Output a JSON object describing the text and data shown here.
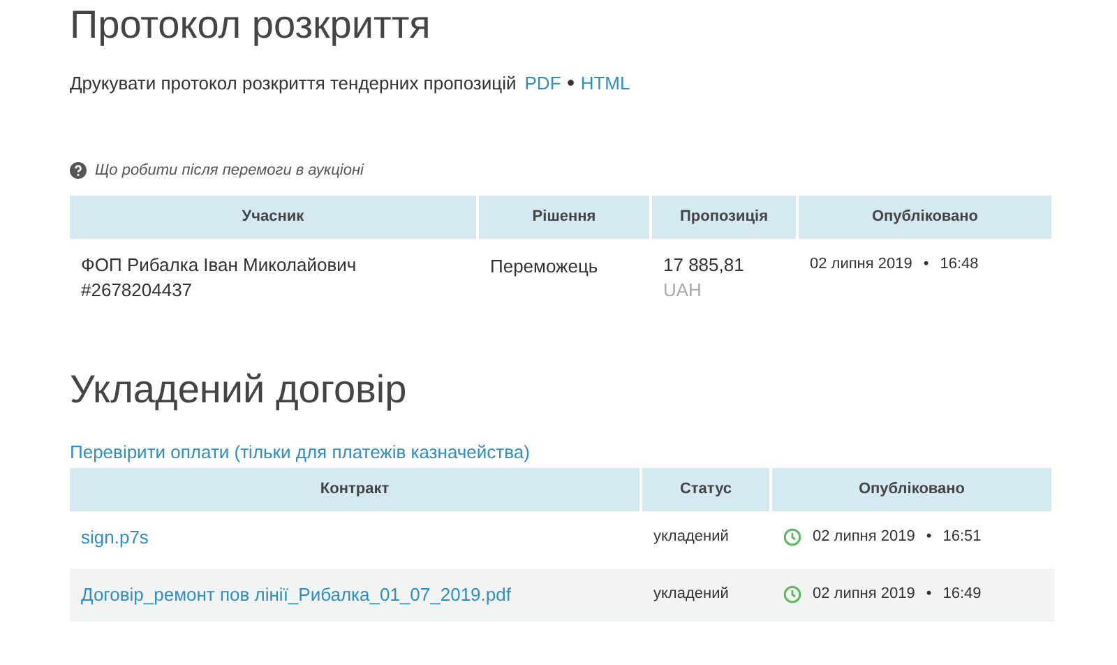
{
  "disclosure": {
    "title": "Протокол розкриття",
    "print_text": "Друкувати протокол розкриття тендерних пропозицій",
    "pdf_link": "PDF",
    "separator": "●",
    "html_link": "HTML"
  },
  "help_link": "Що робити після перемоги в аукціоні",
  "bids_table": {
    "columns": [
      "Учасник",
      "Рішення",
      "Пропозиція",
      "Опубліковано"
    ],
    "rows": [
      {
        "participant": "ФОП Рибалка Іван Миколайович",
        "code": "#2678204437",
        "decision": "Переможець",
        "amount": "17 885,81",
        "currency": "UAH",
        "date": "02 липня 2019",
        "dot": "•",
        "time": "16:48"
      }
    ]
  },
  "contract": {
    "title": "Укладений договір",
    "payments_link": "Перевірити оплати (тільки для платежів казначейства)",
    "columns": [
      "Контракт",
      "Статус",
      "Опубліковано"
    ],
    "rows": [
      {
        "file": "sign.p7s",
        "status": "укладений",
        "date": "02 липня 2019",
        "dot": "•",
        "time": "16:51",
        "shaded": false
      },
      {
        "file": "Договір_ремонт пов лінії_Рибалка_01_07_2019.pdf",
        "status": "укладений",
        "date": "02 липня 2019",
        "dot": "•",
        "time": "16:49",
        "shaded": true
      }
    ]
  }
}
